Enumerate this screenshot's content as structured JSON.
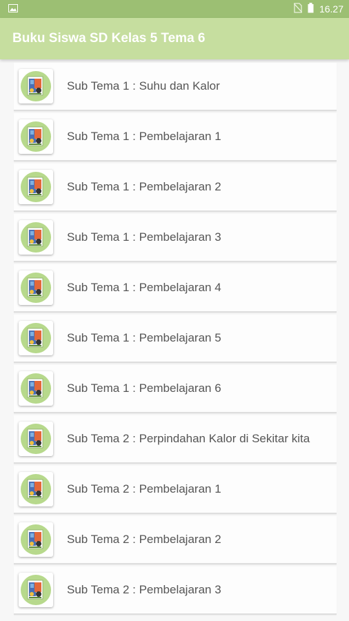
{
  "status_bar": {
    "time": "16.27",
    "icons": [
      "image-icon",
      "no-sim-icon",
      "battery-icon"
    ]
  },
  "app_bar": {
    "title": "Buku Siswa SD Kelas 5 Tema 6"
  },
  "list": {
    "items": [
      {
        "label": "Sub Tema 1 : Suhu dan Kalor"
      },
      {
        "label": "Sub Tema 1 : Pembelajaran 1"
      },
      {
        "label": "Sub Tema 1 : Pembelajaran 2"
      },
      {
        "label": "Sub Tema 1 : Pembelajaran 3"
      },
      {
        "label": "Sub Tema 1 : Pembelajaran 4"
      },
      {
        "label": "Sub Tema 1 : Pembelajaran 5"
      },
      {
        "label": "Sub Tema 1 : Pembelajaran 6"
      },
      {
        "label": "Sub Tema 2 : Perpindahan Kalor di Sekitar kita"
      },
      {
        "label": "Sub Tema 2 : Pembelajaran 1"
      },
      {
        "label": "Sub Tema 2 : Pembelajaran 2"
      },
      {
        "label": "Sub Tema 2 : Pembelajaran 3"
      }
    ]
  },
  "colors": {
    "status_bar": "#9cbf73",
    "app_bar": "#c6de9f",
    "icon_circle": "#b7d98c"
  }
}
